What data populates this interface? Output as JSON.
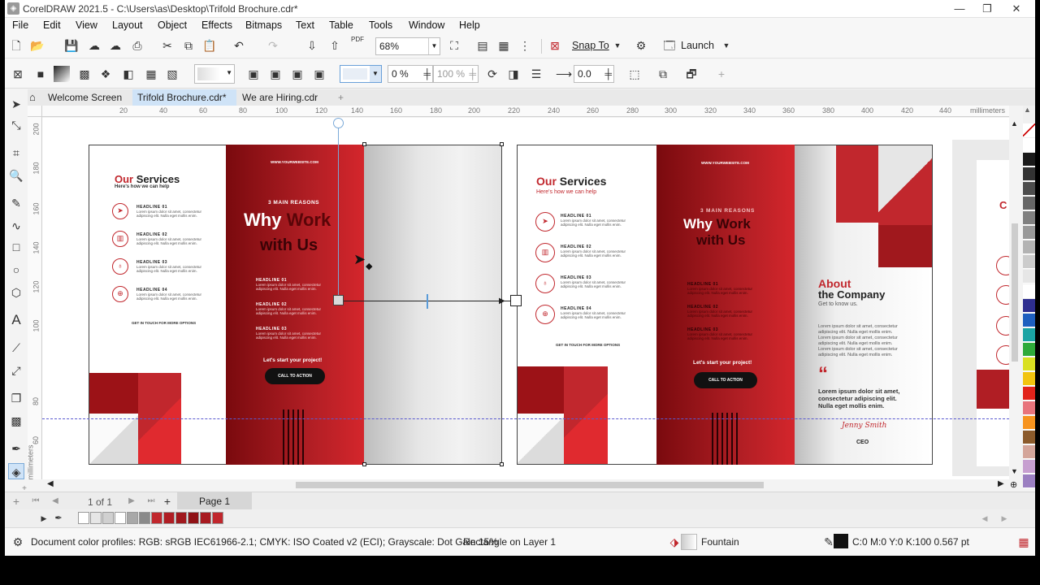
{
  "app": {
    "title": "CorelDRAW 2021.5 - C:\\Users\\as\\Desktop\\Trifold Brochure.cdr*",
    "icon": "coreldraw-logo-icon"
  },
  "menu": [
    "File",
    "Edit",
    "View",
    "Layout",
    "Object",
    "Effects",
    "Bitmaps",
    "Text",
    "Table",
    "Tools",
    "Window",
    "Help"
  ],
  "standard_toolbar": {
    "zoom_value": "68%",
    "snap_to_label": "Snap To",
    "launch_label": "Launch",
    "pdf_label": "PDF"
  },
  "property_bar": {
    "midpoint_value": "0 %",
    "transparency_value": "100 %",
    "angle_value": "0.0"
  },
  "doc_tabs": [
    "Welcome Screen",
    "Trifold Brochure.cdr*",
    "We are Hiring.cdr"
  ],
  "ruler": {
    "unit": "millimeters",
    "h_ticks": [
      "20",
      "40",
      "60",
      "80",
      "100",
      "120",
      "140",
      "160",
      "180",
      "200",
      "220",
      "240",
      "260",
      "280",
      "300",
      "320",
      "340",
      "360",
      "380",
      "400",
      "420",
      "440"
    ],
    "v_ticks": [
      "200",
      "180",
      "160",
      "140",
      "120",
      "100",
      "80",
      "60"
    ],
    "v_unit": "millimeters"
  },
  "brochure_left": {
    "services_title_accent": "Our",
    "services_title": "Services",
    "services_sub": "Here's how we can help",
    "headlines": [
      "HEADLINE 01",
      "HEADLINE 02",
      "HEADLINE 03",
      "HEADLINE 04"
    ],
    "get_in_touch": "GET IN TOUCH FOR MORE OPTIONS",
    "website": "WWW.YOURWEBSITE.COM",
    "reasons": "3 MAIN REASONS",
    "why_word": "Why",
    "work_word": "Work",
    "with_us": "with Us",
    "reason_headlines": [
      "HEADLINE 01",
      "HEADLINE 02",
      "HEADLINE 03"
    ],
    "lets_start": "Let's start your project!",
    "cta": "CALL TO ACTION"
  },
  "brochure_right": {
    "services_title_accent": "Our",
    "services_title": "Services",
    "services_sub": "Here's how we can help",
    "headlines": [
      "HEADLINE 01",
      "HEADLINE 02",
      "HEADLINE 03",
      "HEADLINE 04"
    ],
    "get_in_touch": "GET IN TOUCH FOR MORE OPTIONS",
    "website": "WWW.YOURWEBSITE.COM",
    "reasons": "3 MAIN REASONS",
    "why_word": "Why",
    "work_word": "Work",
    "with_us": "with Us",
    "reason_headlines": [
      "HEADLINE 01",
      "HEADLINE 02",
      "HEADLINE 03"
    ],
    "lets_start": "Let's start your project!",
    "cta": "CALL TO ACTION",
    "about": "About",
    "the_company": "the Company",
    "get_to_know": "Get to know us.",
    "quote_mark": "“",
    "quote": "Lorem ipsum dolor sit amet, consectetur adipiscing elit. Nulla eget mollis enim.",
    "signature": "Jenny Smith",
    "ceo": "CEO"
  },
  "lorem": "Lorem ipsum dolor sit amet, consectetur adipiscing elit. Nulla eget mollis enim.",
  "page_nav": {
    "page_counter": "1 of 1",
    "page_tab": "Page 1"
  },
  "status": {
    "color_profiles": "Document color profiles: RGB: sRGB IEC61966-2.1; CMYK: ISO Coated v2 (ECI); Grayscale: Dot Gain 15%",
    "selection": "Rectangle on Layer 1",
    "fill_type": "Fountain",
    "outline": "C:0 M:0 Y:0 K:100  0.567 pt"
  },
  "colors": {
    "brand_red": "#c1272d",
    "dark_red": "#7a0a0e",
    "black": "#111111"
  },
  "palette_colors": [
    "#ffffff",
    "#1a1a1a",
    "#333333",
    "#4d4d4d",
    "#666666",
    "#808080",
    "#999999",
    "#b3b3b3",
    "#cccccc",
    "#e6e6e6",
    "#ffffff",
    "#2e2e8f",
    "#1e5fbf",
    "#1aa3a3",
    "#2eaa3a",
    "#d9e021",
    "#f2c40f",
    "#e2231a",
    "#e8747c",
    "#f7931e",
    "#8b5a2b",
    "#d4a59a",
    "#c79fd0",
    "#9b7fc1"
  ],
  "doc_palette_colors": [
    "#ffffff",
    "#e6e6e6",
    "#d0d0d0",
    "#ffffff",
    "#a8a8a8",
    "#8a8a8a",
    "#c1272d",
    "#b01e24",
    "#a0181d",
    "#901216",
    "#a81a20",
    "#c1272d"
  ]
}
